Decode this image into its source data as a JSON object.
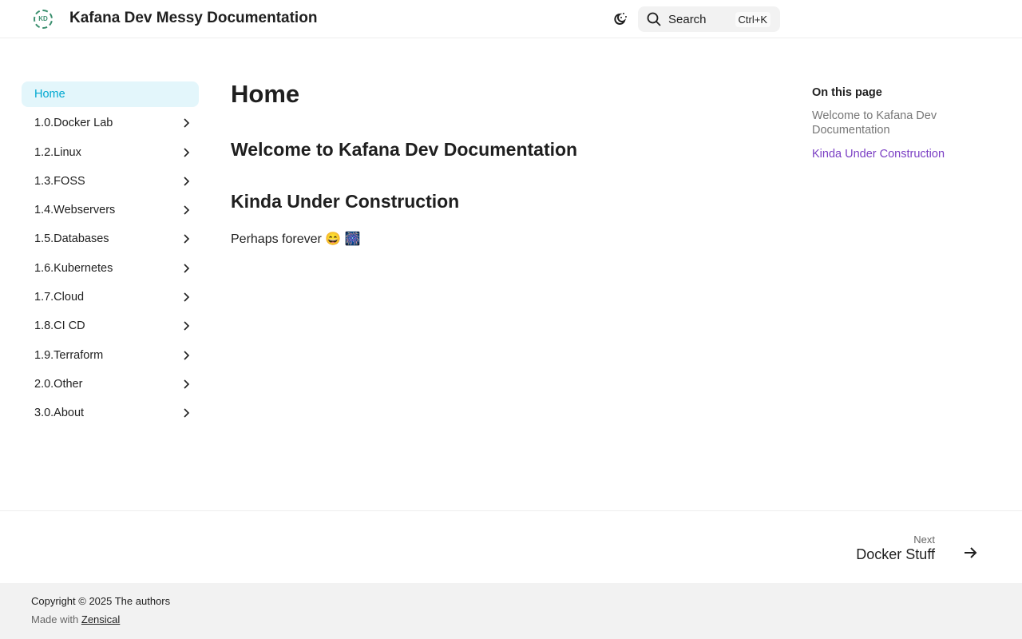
{
  "header": {
    "logo_text": "KD",
    "title": "Kafana Dev Messy Documentation",
    "search_label": "Search",
    "search_shortcut": "Ctrl+K"
  },
  "sidebar": {
    "items": [
      {
        "label": "Home",
        "active": true
      },
      {
        "label": "1.0.Docker Lab"
      },
      {
        "label": "1.2.Linux"
      },
      {
        "label": "1.3.FOSS"
      },
      {
        "label": "1.4.Webservers"
      },
      {
        "label": "1.5.Databases"
      },
      {
        "label": "1.6.Kubernetes"
      },
      {
        "label": "1.7.Cloud"
      },
      {
        "label": "1.8.CI CD"
      },
      {
        "label": "1.9.Terraform"
      },
      {
        "label": "2.0.Other"
      },
      {
        "label": "3.0.About"
      }
    ]
  },
  "main": {
    "title": "Home",
    "h2_1": "Welcome to Kafana Dev Documentation",
    "h2_2": "Kinda Under Construction",
    "text": "Perhaps forever 😄 🎆"
  },
  "toc": {
    "title": "On this page",
    "items": [
      "Welcome to Kafana Dev Documentation",
      "Kinda Under Construction"
    ]
  },
  "next": {
    "label": "Next",
    "title": "Docker Stuff"
  },
  "footer": {
    "copyright": "Copyright © 2025 The authors",
    "made_with": "Made with",
    "link": "Zensical"
  }
}
